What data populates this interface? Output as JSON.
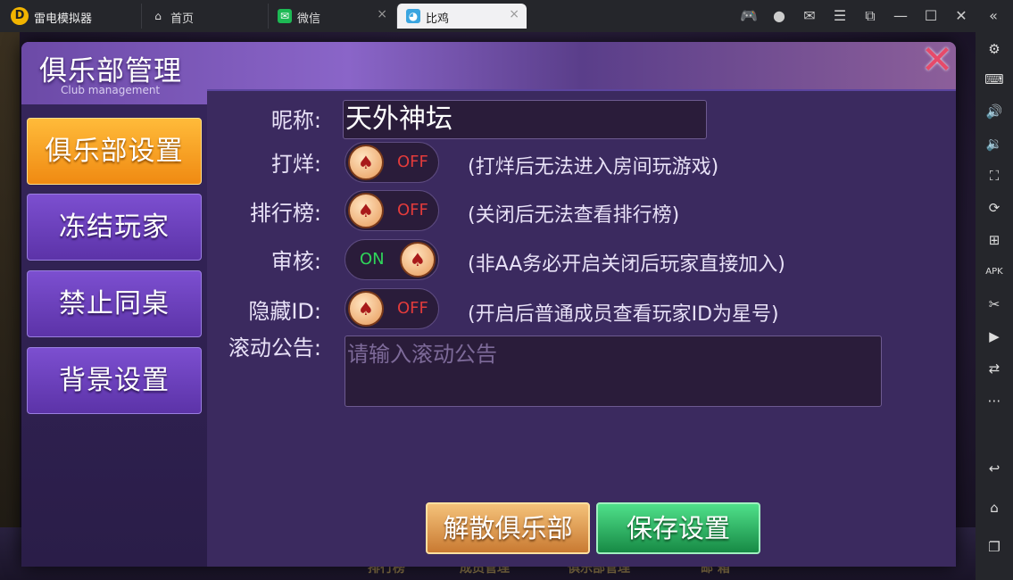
{
  "emulator": {
    "app_name": "雷电模拟器",
    "logo_glyph": "D",
    "tabs": [
      {
        "label": "首页",
        "icon": "home-icon",
        "glyph": "⌂"
      },
      {
        "label": "微信",
        "icon": "wechat-icon",
        "glyph": "✉"
      },
      {
        "label": "比鸡",
        "icon": "game-icon",
        "glyph": "◕",
        "active": true
      }
    ],
    "close_glyph": "×"
  },
  "dialog": {
    "title": "俱乐部管理",
    "subtitle": "Club management",
    "close_glyph": "✕"
  },
  "sidebar": {
    "items": [
      {
        "label": "俱乐部设置",
        "active": true
      },
      {
        "label": "冻结玩家"
      },
      {
        "label": "禁止同桌"
      },
      {
        "label": "背景设置"
      }
    ]
  },
  "settings": {
    "nickname_label": "昵称:",
    "nickname_value": "天外神坛",
    "rows": [
      {
        "label": "打烊:",
        "state": "OFF",
        "hint": "(打烊后无法进入房间玩游戏)"
      },
      {
        "label": "排行榜:",
        "state": "OFF",
        "hint": "(关闭后无法查看排行榜)"
      },
      {
        "label": "审核:",
        "state": "ON",
        "hint": "(非AA务必开启关闭后玩家直接加入)"
      },
      {
        "label": "隐藏ID:",
        "state": "OFF",
        "hint": "(开启后普通成员查看玩家ID为星号)"
      }
    ],
    "knob_glyph": "♠",
    "notice_label": "滚动公告:",
    "notice_placeholder": "请输入滚动公告"
  },
  "actions": {
    "disband_label": "解散俱乐部",
    "save_label": "保存设置"
  },
  "background_nav": [
    "排行榜",
    "成员管理",
    "俱乐部管理",
    "邮 箱"
  ],
  "colors": {
    "active_tab": "#f39a1a",
    "off": "#e23b3b",
    "on": "#2fd65a",
    "save": "#1fa85a",
    "disband": "#d4863c"
  }
}
